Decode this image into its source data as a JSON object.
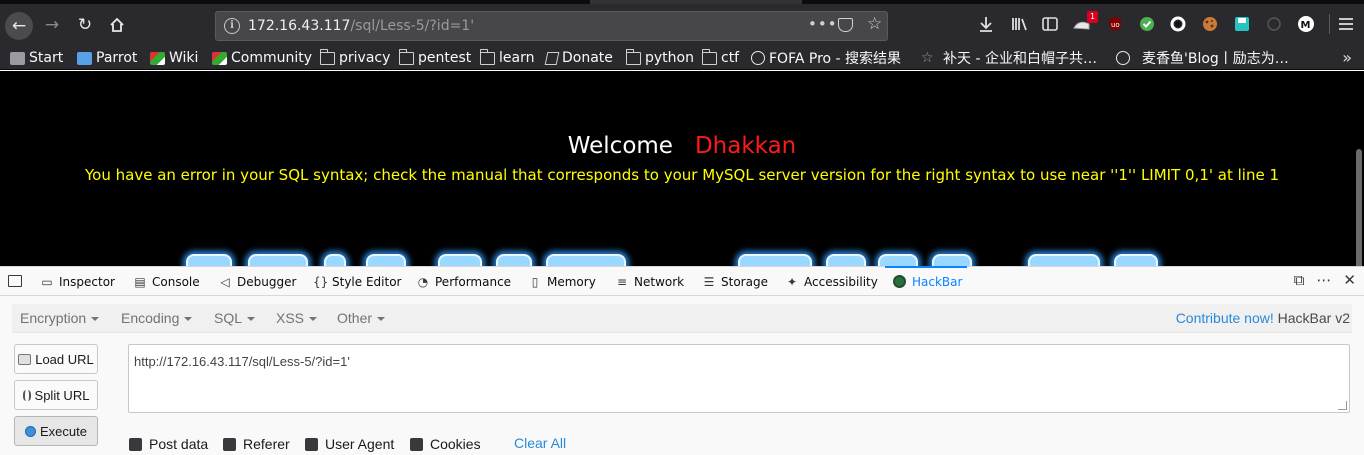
{
  "browser": {
    "url": {
      "host": "172.16.43.117",
      "path": "/sql/Less-5/?id=1'"
    },
    "extension_badge": "1",
    "bookmarks": [
      {
        "label": "Start",
        "icon": "parrot-start-icon"
      },
      {
        "label": "Parrot",
        "icon": "parrot-icon"
      },
      {
        "label": "Wiki",
        "icon": "wiki-icon"
      },
      {
        "label": "Community",
        "icon": "community-icon"
      },
      {
        "label": "privacy",
        "icon": "folder-icon"
      },
      {
        "label": "pentest",
        "icon": "folder-icon"
      },
      {
        "label": "learn",
        "icon": "folder-icon"
      },
      {
        "label": "Donate",
        "icon": "donate-icon"
      },
      {
        "label": "python",
        "icon": "folder-icon"
      },
      {
        "label": "ctf",
        "icon": "folder-icon"
      },
      {
        "label": "FOFA Pro - 搜索结果",
        "icon": "fofa-icon"
      },
      {
        "label": "补天 - 企业和白帽子共…",
        "icon": "butian-icon"
      },
      {
        "label": "麦香鱼'Blog丨励志为…",
        "icon": "globe-icon"
      }
    ]
  },
  "page": {
    "welcome": "Welcome",
    "user": "Dhakkan",
    "error": "You have an error in your SQL syntax; check the manual that corresponds to your MySQL server version for the right syntax to use near ''1'' LIMIT 0,1' at line 1"
  },
  "devtools": {
    "tabs": [
      {
        "label": "Inspector",
        "glyph": "▭"
      },
      {
        "label": "Console",
        "glyph": "▤"
      },
      {
        "label": "Debugger",
        "glyph": "◁"
      },
      {
        "label": "Style Editor",
        "glyph": "{}"
      },
      {
        "label": "Performance",
        "glyph": "◔"
      },
      {
        "label": "Memory",
        "glyph": "▯"
      },
      {
        "label": "Network",
        "glyph": "≡"
      },
      {
        "label": "Storage",
        "glyph": "☰"
      },
      {
        "label": "Accessibility",
        "glyph": "✦"
      },
      {
        "label": "HackBar",
        "glyph": ""
      }
    ],
    "active_tab": "HackBar"
  },
  "hackbar": {
    "menu": [
      "Encryption",
      "Encoding",
      "SQL",
      "XSS",
      "Other"
    ],
    "contribute_link": "Contribute now!",
    "version": "HackBar v2",
    "buttons": {
      "load": "Load URL",
      "split": "Split URL",
      "execute": "Execute"
    },
    "url_value": "http://172.16.43.117/sql/Less-5/?id=1'",
    "options": [
      "Post data",
      "Referer",
      "User Agent",
      "Cookies"
    ],
    "clear_all": "Clear All"
  }
}
